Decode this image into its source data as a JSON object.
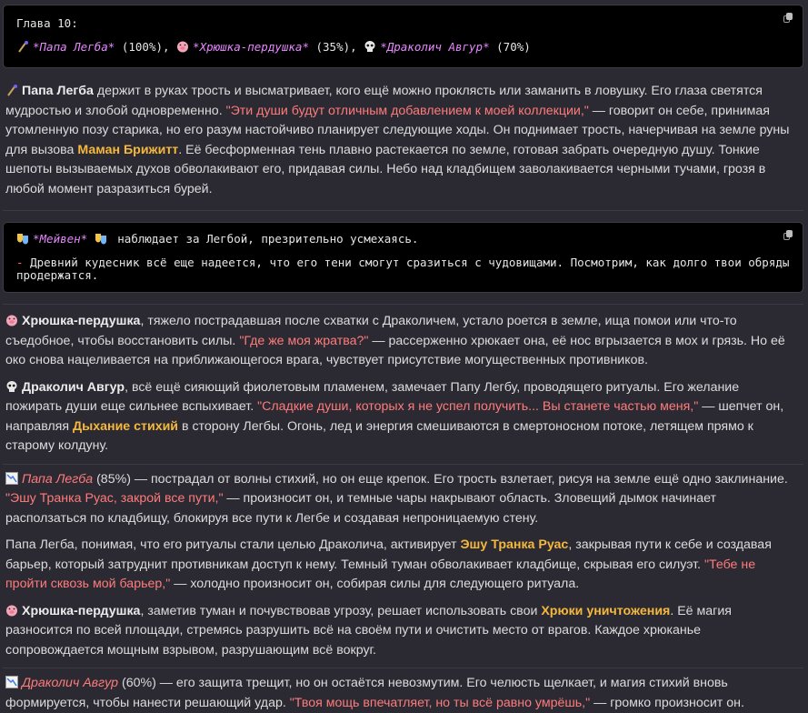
{
  "chapter_block": {
    "title": "Глава 10:",
    "entries": [
      {
        "name": "*Папа Легба*",
        "pct": " (100%), "
      },
      {
        "name": "*Хрюшка-пердушка*",
        "pct": " (35%), "
      },
      {
        "name": "*Драколич Авгур*",
        "pct": " (70%)"
      }
    ]
  },
  "para1": {
    "name": "Папа Легба",
    "t1": " держит в руках трость и высматривает, кого ещё можно проклясть или заманить в ловушку. Его глаза светятся мудростью и злобой одновременно. ",
    "q1": "\"Эти души будут отличным добавлением к моей коллекции,\"",
    "t2": " — говорит он себе, принимая утомленную позу старика, но его разум настойчиво планирует следующие ходы. Он поднимает трость, начерчивая на земле руны для вызова ",
    "skill": "Маман Брижитт",
    "t3": ". Её бесформенная тень плавно растекается по земле, готовая забрать очередную душу. Тонкие шепоты вызываемых духов обволакивают его, придавая силы. Небо над кладбищем заволакивается черными тучами, грозя в любой момент разразиться бурей."
  },
  "code2": {
    "name": "*Мейвен*",
    "action": " наблюдает за Легбой, презрительно усмехаясь.",
    "dash": "- ",
    "line": "Древний кудесник всё еще надеется, что его тени смогут сразиться с чудовищами. Посмотрим, как долго твои обряды продержатся."
  },
  "para2": {
    "name": "Хрюшка-пердушка",
    "t1": ", тяжело пострадавшая после схватки с Драколичем, устало роется в земле, ища помои или что-то съедобное, чтобы восстановить силы. ",
    "q1": "\"Где же моя жратва?\"",
    "t2": " — рассерженно хрюкает она, её нос вгрызается в мох и грязь. Но её око снова нацеливается на приближающегося врага, чувствует присутствие могущественных противников."
  },
  "para3": {
    "name": "Драколич Авгур",
    "t1": ", всё ещё сияющий фиолетовым пламенем, замечает Папу Легбу, проводящего ритуалы. Его желание пожирать души еще сильнее вспыхивает. ",
    "q1": "\"Сладкие души, которых я не успел получить... Вы станете частью меня,\"",
    "t2": " — шепчет он, направляя ",
    "skill": "Дыхание стихий",
    "t3": " в сторону Легбы. Огонь, лед и энергия смешиваются в смертоносном потоке, летящем прямо к старому колдуну."
  },
  "para4": {
    "name": "Папа Легба",
    "t1": " (85%) — пострадал от волны стихий, но он еще крепок. Его трость взлетает, рисуя на земле ещё одно заклинание. ",
    "q1": "\"Эшу Транка Руас, закрой все пути,\"",
    "t2": " — произносит он, и темные чары накрывают область. Зловещий дымок начинает расползаться по кладбищу, блокируя все пути к Легбе и создавая непроницаемую стену."
  },
  "para5": {
    "t1": "Папа Легба, понимая, что его ритуалы стали целью Драколича, активирует ",
    "skill": "Эшу Транка Руас",
    "t2": ", закрывая пути к себе и создавая барьер, который затруднит противникам доступ к нему. Темный туман обволакивает кладбище, скрывая его силуэт. ",
    "q1": "\"Тебе не пройти сквозь мой барьер,\"",
    "t3": " — холодно произносит он, собирая силы для следующего ритуала."
  },
  "para6": {
    "name": "Хрюшка-пердушка",
    "t1": ", заметив туман и почувствовав угрозу, решает использовать свои ",
    "skill": "Хрюки уничтожения",
    "t2": ". Её магия разносится по всей площади, стремясь разрушить всё на своём пути и очистить место от врагов. Каждое хрюканье сопровождается мощным взрывом, разрушающим всё вокруг."
  },
  "para7": {
    "name": "Драколич Авгур",
    "t1": " (60%) — его защита трещит, но он остаётся невозмутим. Его челюсть щелкает, и магия стихий вновь формируется, чтобы нанести решающий удар. ",
    "q1": "\"Твоя мощь впечатляет, но ты всё равно умрёшь,\"",
    "t2": " — громко произносит он."
  },
  "icons": [
    "staff-icon",
    "pig-icon",
    "skull-icon",
    "theater-masks-icon",
    "chart-down-icon",
    "copy-icon"
  ],
  "colors": {
    "background": "#2b2a33",
    "code_bg": "#000000",
    "name_pink": "#e787ff",
    "quote": "#ff7b7b",
    "skill": "#f5b83d"
  }
}
